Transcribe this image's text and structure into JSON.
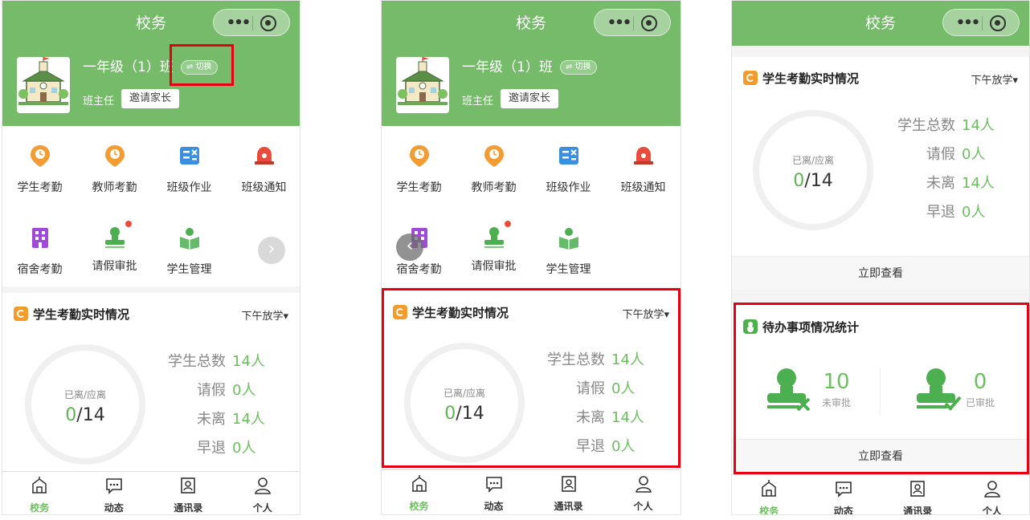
{
  "app": {
    "title": "校务",
    "capsule_dots": "•••"
  },
  "header": {
    "class_name": "一年级（1）班",
    "switch_label": "⇌ 切换",
    "role": "班主任",
    "invite_label": "邀请家长"
  },
  "grid": {
    "items": [
      {
        "label": "学生考勤",
        "icon": "clock-icon",
        "color": "#f39c33"
      },
      {
        "label": "教师考勤",
        "icon": "clock-icon",
        "color": "#f39c33"
      },
      {
        "label": "班级作业",
        "icon": "homework-icon",
        "color": "#3b8fe0"
      },
      {
        "label": "班级通知",
        "icon": "bell-icon",
        "color": "#e94c3d"
      },
      {
        "label": "宿舍考勤",
        "icon": "building-icon",
        "color": "#a04ad8"
      },
      {
        "label": "请假审批",
        "icon": "stamp-icon",
        "color": "#4caf50"
      },
      {
        "label": "学生管理",
        "icon": "reader-icon",
        "color": "#4caf50"
      }
    ]
  },
  "attendance": {
    "title": "学生考勤实时情况",
    "filter": "下午放学▾",
    "ring_label": "已离/应离",
    "left_value": "0",
    "total_value": "/14",
    "stats": [
      {
        "label": "学生总数",
        "value": "14人"
      },
      {
        "label": "请假",
        "value": "0人"
      },
      {
        "label": "未离",
        "value": "14人"
      },
      {
        "label": "早退",
        "value": "0人"
      }
    ],
    "view_label": "立即查看"
  },
  "todo": {
    "title": "待办事项情况统计",
    "pending_count": "10",
    "pending_label": "未审批",
    "done_count": "0",
    "done_label": "已审批",
    "view_label": "立即查看"
  },
  "tabbar": {
    "items": [
      {
        "label": "校务",
        "icon": "school-icon",
        "active": true
      },
      {
        "label": "动态",
        "icon": "chat-icon",
        "active": false
      },
      {
        "label": "通讯录",
        "icon": "contacts-icon",
        "active": false
      },
      {
        "label": "个人",
        "icon": "person-icon",
        "active": false
      }
    ]
  },
  "colors": {
    "brand_green": "#75bb6a",
    "value_green": "#6cbf5e",
    "highlight_red": "#e60012"
  }
}
